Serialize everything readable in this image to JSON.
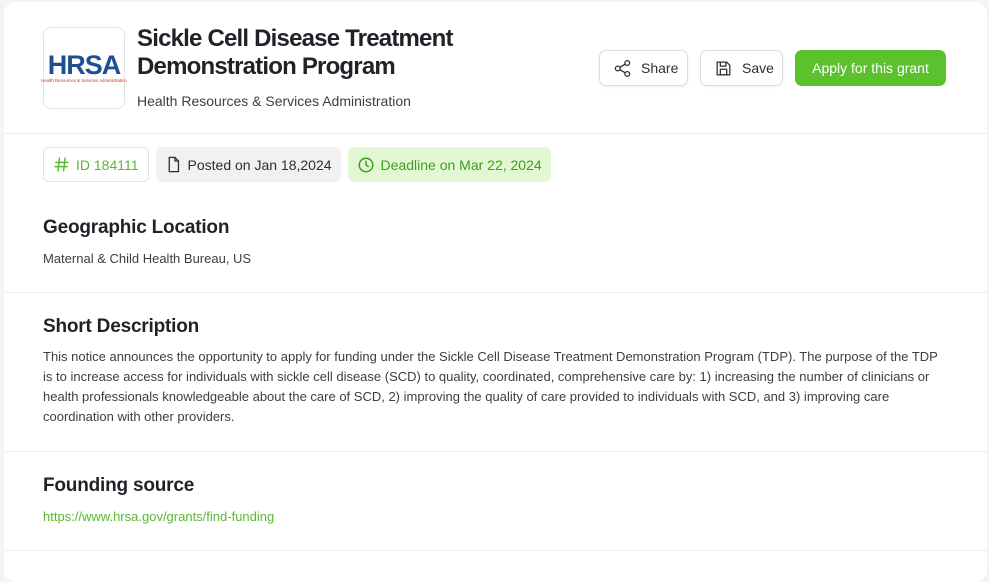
{
  "header": {
    "logo_text": "HRSA",
    "logo_sub": "Health Resources & Services Administration",
    "title": "Sickle Cell Disease Treatment Demonstration Program",
    "subtitle": "Health Resources & Services Administration"
  },
  "actions": {
    "share_label": "Share",
    "save_label": "Save",
    "apply_label": "Apply for this grant"
  },
  "tags": {
    "id_label": "ID 184111",
    "posted_label": "Posted on Jan 18,2024",
    "deadline_label": "Deadline on Mar 22, 2024"
  },
  "sections": {
    "geo": {
      "heading": "Geographic Location",
      "text": "Maternal & Child Health Bureau, US"
    },
    "description": {
      "heading": "Short Description",
      "text": "This notice announces the opportunity to apply for funding under the Sickle Cell Disease Treatment Demonstration Program (TDP). The purpose of the TDP is to increase access for individuals with sickle cell disease (SCD) to quality, coordinated, comprehensive care by: 1) increasing the number of clinicians or health professionals knowledgeable about the care of SCD, 2) improving the quality of care provided to individuals with SCD, and 3) improving care coordination with other providers."
    },
    "source": {
      "heading": "Founding source",
      "link": "https://www.hrsa.gov/grants/find-funding"
    }
  },
  "colors": {
    "accent": "#5cc12f",
    "accent_text": "#59b833",
    "deadline_bg": "#e2f8d3",
    "logo_blue": "#1d4f91"
  },
  "icons": [
    "share-icon",
    "save-icon",
    "hash-icon",
    "document-icon",
    "clock-icon"
  ]
}
